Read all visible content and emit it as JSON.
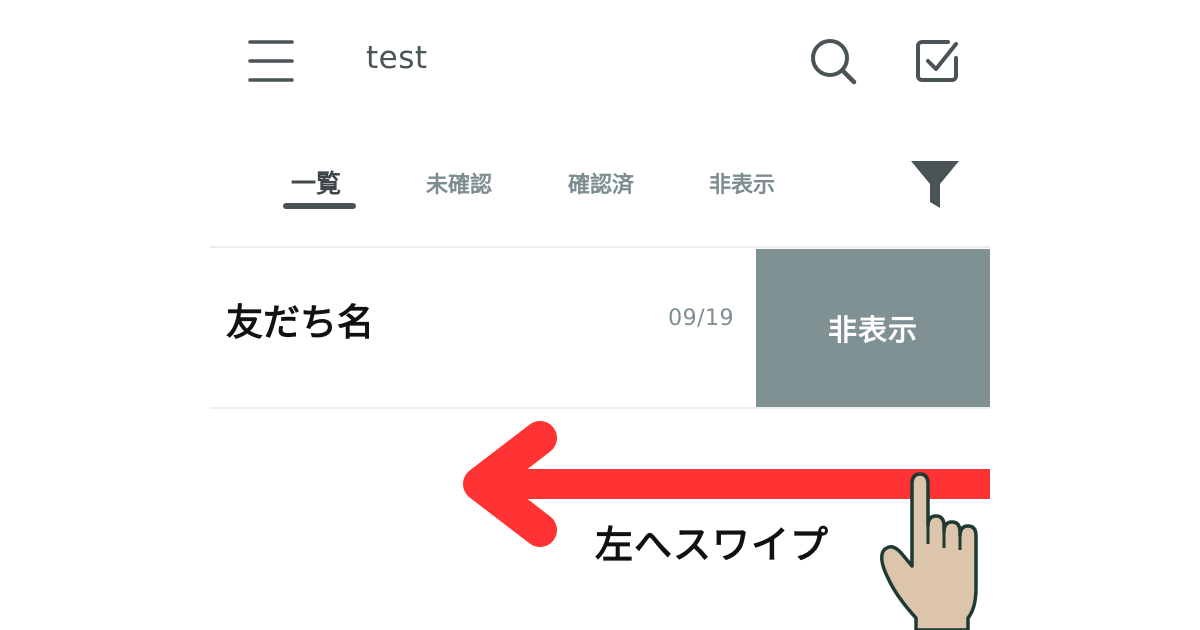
{
  "header": {
    "title": "test",
    "menu_icon": "hamburger-icon",
    "search_icon": "search-icon",
    "check_icon": "checkbox-icon"
  },
  "tabs": [
    {
      "label": "一覧",
      "active": true
    },
    {
      "label": "未確認",
      "active": false
    },
    {
      "label": "確認済",
      "active": false
    },
    {
      "label": "非表示",
      "active": false
    }
  ],
  "filter_icon": "filter-icon",
  "list": {
    "rows": [
      {
        "name": "友だち名",
        "date": "09/19",
        "swipe_action": "非表示"
      }
    ]
  },
  "hint": {
    "caption": "左へスワイプ",
    "arrow_color": "#ff3333",
    "hand_color": "#dcc5aa"
  },
  "colors": {
    "action_bg": "#7f9193",
    "text_dark": "#3f474a",
    "text_muted": "#7c8c8f"
  }
}
